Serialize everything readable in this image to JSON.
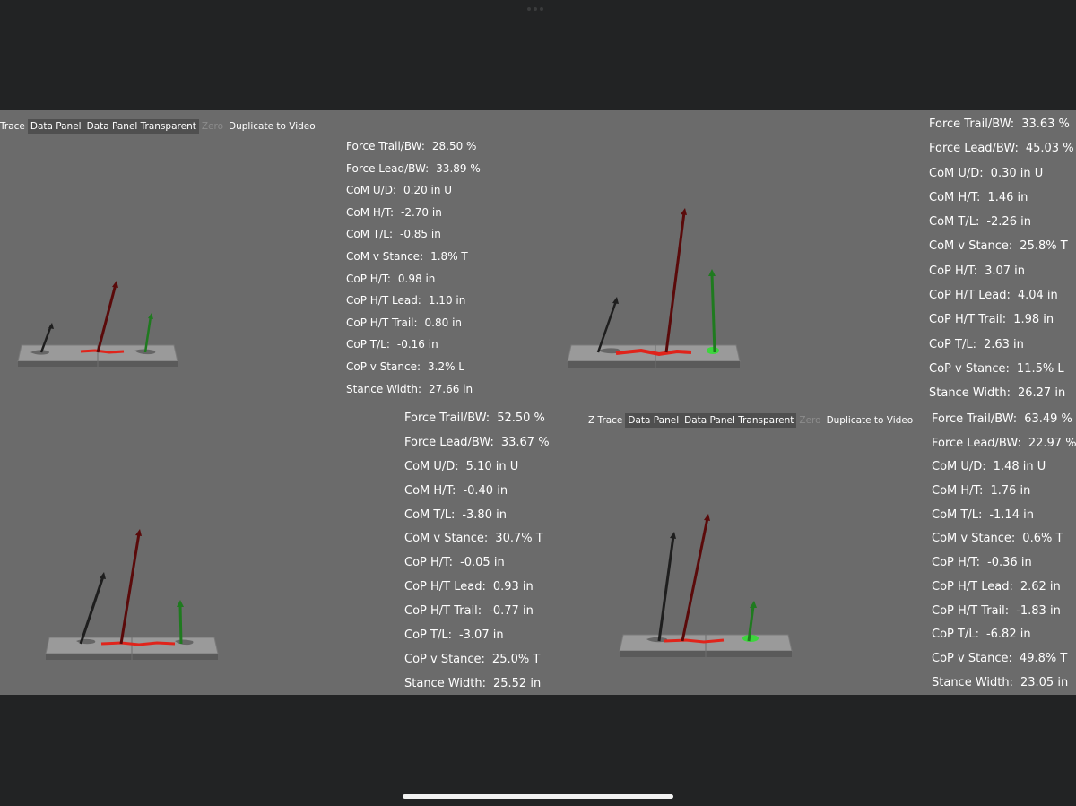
{
  "toolbar_top_left": {
    "z_trace": "Trace",
    "data_panel": "Data Panel",
    "data_panel_transparent": "Data Panel Transparent",
    "zero": "Zero",
    "duplicate_to_video": "Duplicate to Video"
  },
  "toolbar_bottom_right": {
    "z_trace": "Z Trace",
    "data_panel": "Data Panel",
    "data_panel_transparent": "Data Panel Transparent",
    "zero": "Zero",
    "duplicate_to_video": "Duplicate to Video"
  },
  "panels": {
    "top_left": [
      {
        "label": "Force Trail/BW:",
        "value": "28.50 %"
      },
      {
        "label": "Force Lead/BW:",
        "value": "33.89 %"
      },
      {
        "label": "CoM U/D:",
        "value": "0.20 in U"
      },
      {
        "label": "CoM H/T:",
        "value": "-2.70 in"
      },
      {
        "label": "CoM T/L:",
        "value": "-0.85 in"
      },
      {
        "label": "CoM v Stance:",
        "value": "1.8% T"
      },
      {
        "label": "CoP H/T:",
        "value": "0.98 in"
      },
      {
        "label": "CoP H/T Lead:",
        "value": "1.10 in"
      },
      {
        "label": "CoP H/T Trail:",
        "value": "0.80 in"
      },
      {
        "label": "CoP T/L:",
        "value": "-0.16 in"
      },
      {
        "label": "CoP v Stance:",
        "value": "3.2% L"
      },
      {
        "label": "Stance Width:",
        "value": "27.66 in"
      }
    ],
    "top_right": [
      {
        "label": "Force Trail/BW:",
        "value": "33.63 %"
      },
      {
        "label": "Force Lead/BW:",
        "value": "45.03 %"
      },
      {
        "label": "CoM U/D:",
        "value": "0.30 in U"
      },
      {
        "label": "CoM H/T:",
        "value": "1.46 in"
      },
      {
        "label": "CoM T/L:",
        "value": "-2.26 in"
      },
      {
        "label": "CoM v Stance:",
        "value": "25.8% T"
      },
      {
        "label": "CoP H/T:",
        "value": "3.07 in"
      },
      {
        "label": "CoP H/T Lead:",
        "value": "4.04 in"
      },
      {
        "label": "CoP H/T Trail:",
        "value": "1.98 in"
      },
      {
        "label": "CoP T/L:",
        "value": "2.63 in"
      },
      {
        "label": "CoP v Stance:",
        "value": "11.5% L"
      },
      {
        "label": "Stance Width:",
        "value": "26.27 in"
      }
    ],
    "bottom_left": [
      {
        "label": "Force Trail/BW:",
        "value": "52.50 %"
      },
      {
        "label": "Force Lead/BW:",
        "value": "33.67 %"
      },
      {
        "label": "CoM U/D:",
        "value": "5.10 in U"
      },
      {
        "label": "CoM H/T:",
        "value": "-0.40 in"
      },
      {
        "label": "CoM T/L:",
        "value": "-3.80 in"
      },
      {
        "label": "CoM v Stance:",
        "value": "30.7% T"
      },
      {
        "label": "CoP H/T:",
        "value": "-0.05 in"
      },
      {
        "label": "CoP H/T Lead:",
        "value": "0.93 in"
      },
      {
        "label": "CoP H/T Trail:",
        "value": "-0.77 in"
      },
      {
        "label": "CoP T/L:",
        "value": "-3.07 in"
      },
      {
        "label": "CoP v Stance:",
        "value": "25.0% T"
      },
      {
        "label": "Stance Width:",
        "value": "25.52 in"
      }
    ],
    "bottom_right": [
      {
        "label": "Force Trail/BW:",
        "value": "63.49 %"
      },
      {
        "label": "Force Lead/BW:",
        "value": "22.97 %"
      },
      {
        "label": "CoM U/D:",
        "value": "1.48 in U"
      },
      {
        "label": "CoM H/T:",
        "value": "1.76 in"
      },
      {
        "label": "CoM T/L:",
        "value": "-1.14 in"
      },
      {
        "label": "CoM v Stance:",
        "value": "0.6% T"
      },
      {
        "label": "CoP H/T:",
        "value": "-0.36 in"
      },
      {
        "label": "CoP H/T Lead:",
        "value": "2.62 in"
      },
      {
        "label": "CoP H/T Trail:",
        "value": "-1.83 in"
      },
      {
        "label": "CoP T/L:",
        "value": "-6.82 in"
      },
      {
        "label": "CoP v Stance:",
        "value": "49.8% T"
      },
      {
        "label": "Stance Width:",
        "value": "23.05 in"
      }
    ]
  },
  "colors": {
    "viewport_bg": "#6b6b6b",
    "trail_vector": "#1e1e1e",
    "total_vector": "#5a0a0a",
    "lead_vector": "#1f7a1f",
    "cop_trace": "#e0241b",
    "plate": "#9a9a9a"
  }
}
